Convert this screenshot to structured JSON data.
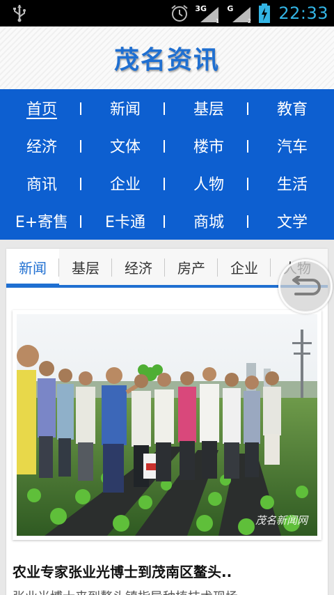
{
  "status_bar": {
    "time": "22:33",
    "network_1": "3G",
    "network_2": "G",
    "icons": [
      "usb-icon",
      "alarm-icon",
      "signal-icon",
      "battery-charging-icon"
    ]
  },
  "header": {
    "title": "茂名资讯"
  },
  "nav": {
    "rows": [
      [
        "首页",
        "新闻",
        "基层",
        "教育"
      ],
      [
        "经济",
        "文体",
        "楼市",
        "汽车"
      ],
      [
        "商讯",
        "企业",
        "人物",
        "生活"
      ],
      [
        "E+寄售",
        "E卡通",
        "商城",
        "文学"
      ]
    ],
    "active": "首页"
  },
  "tabs": {
    "items": [
      "新闻",
      "基层",
      "经济",
      "房产",
      "企业",
      "人物"
    ],
    "active": "新闻"
  },
  "article": {
    "image_watermark": "茂名新闻网",
    "headline": "农业专家张业光博士到茂南区鳌头..",
    "summary": "张业光博士来到鳌头镇指导种植技术现场"
  },
  "colors": {
    "brand_blue": "#0d5fd0",
    "title_blue": "#1f6fd1",
    "status_accent": "#33b5e5"
  }
}
